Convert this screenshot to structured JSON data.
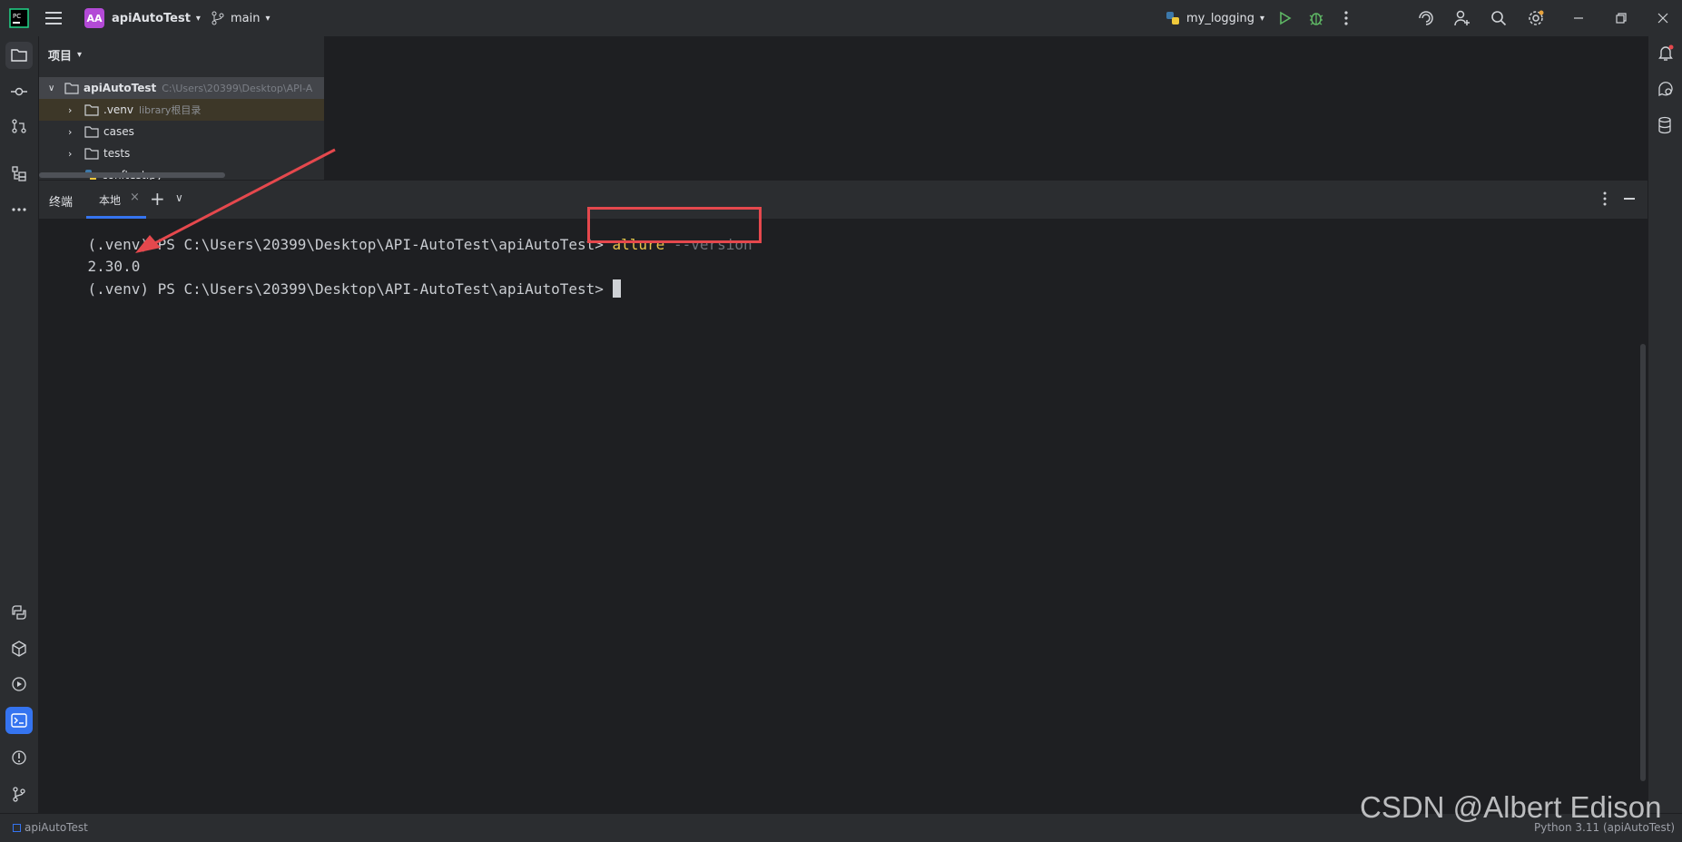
{
  "titlebar": {
    "app_badge": "AA",
    "project_name": "apiAutoTest",
    "branch": "main",
    "run_config": "my_logging"
  },
  "project_panel": {
    "title": "项目",
    "tree": [
      {
        "name": "apiAutoTest",
        "hint": "C:\\Users\\20399\\Desktop\\API-A"
      },
      {
        "name": ".venv",
        "hint": "library根目录"
      },
      {
        "name": "cases",
        "hint": ""
      },
      {
        "name": "tests",
        "hint": ""
      },
      {
        "name": "conftest.py",
        "hint": ""
      }
    ]
  },
  "terminal": {
    "panel_title": "终端",
    "tab_label": "本地",
    "prompt": "(.venv) PS C:\\Users\\20399\\Desktop\\API-AutoTest\\apiAutoTest>",
    "command": "allure",
    "command_arg": "--version",
    "output": "2.30.0"
  },
  "statusbar": {
    "project": "apiAutoTest",
    "interpreter": "Python 3.11 (apiAutoTest)"
  },
  "watermark": "CSDN @Albert Edison",
  "colors": {
    "accent_blue": "#3574f0",
    "highlight_red": "#e5484d",
    "command_yellow": "#e8c24a",
    "run_green": "#5fb865"
  }
}
